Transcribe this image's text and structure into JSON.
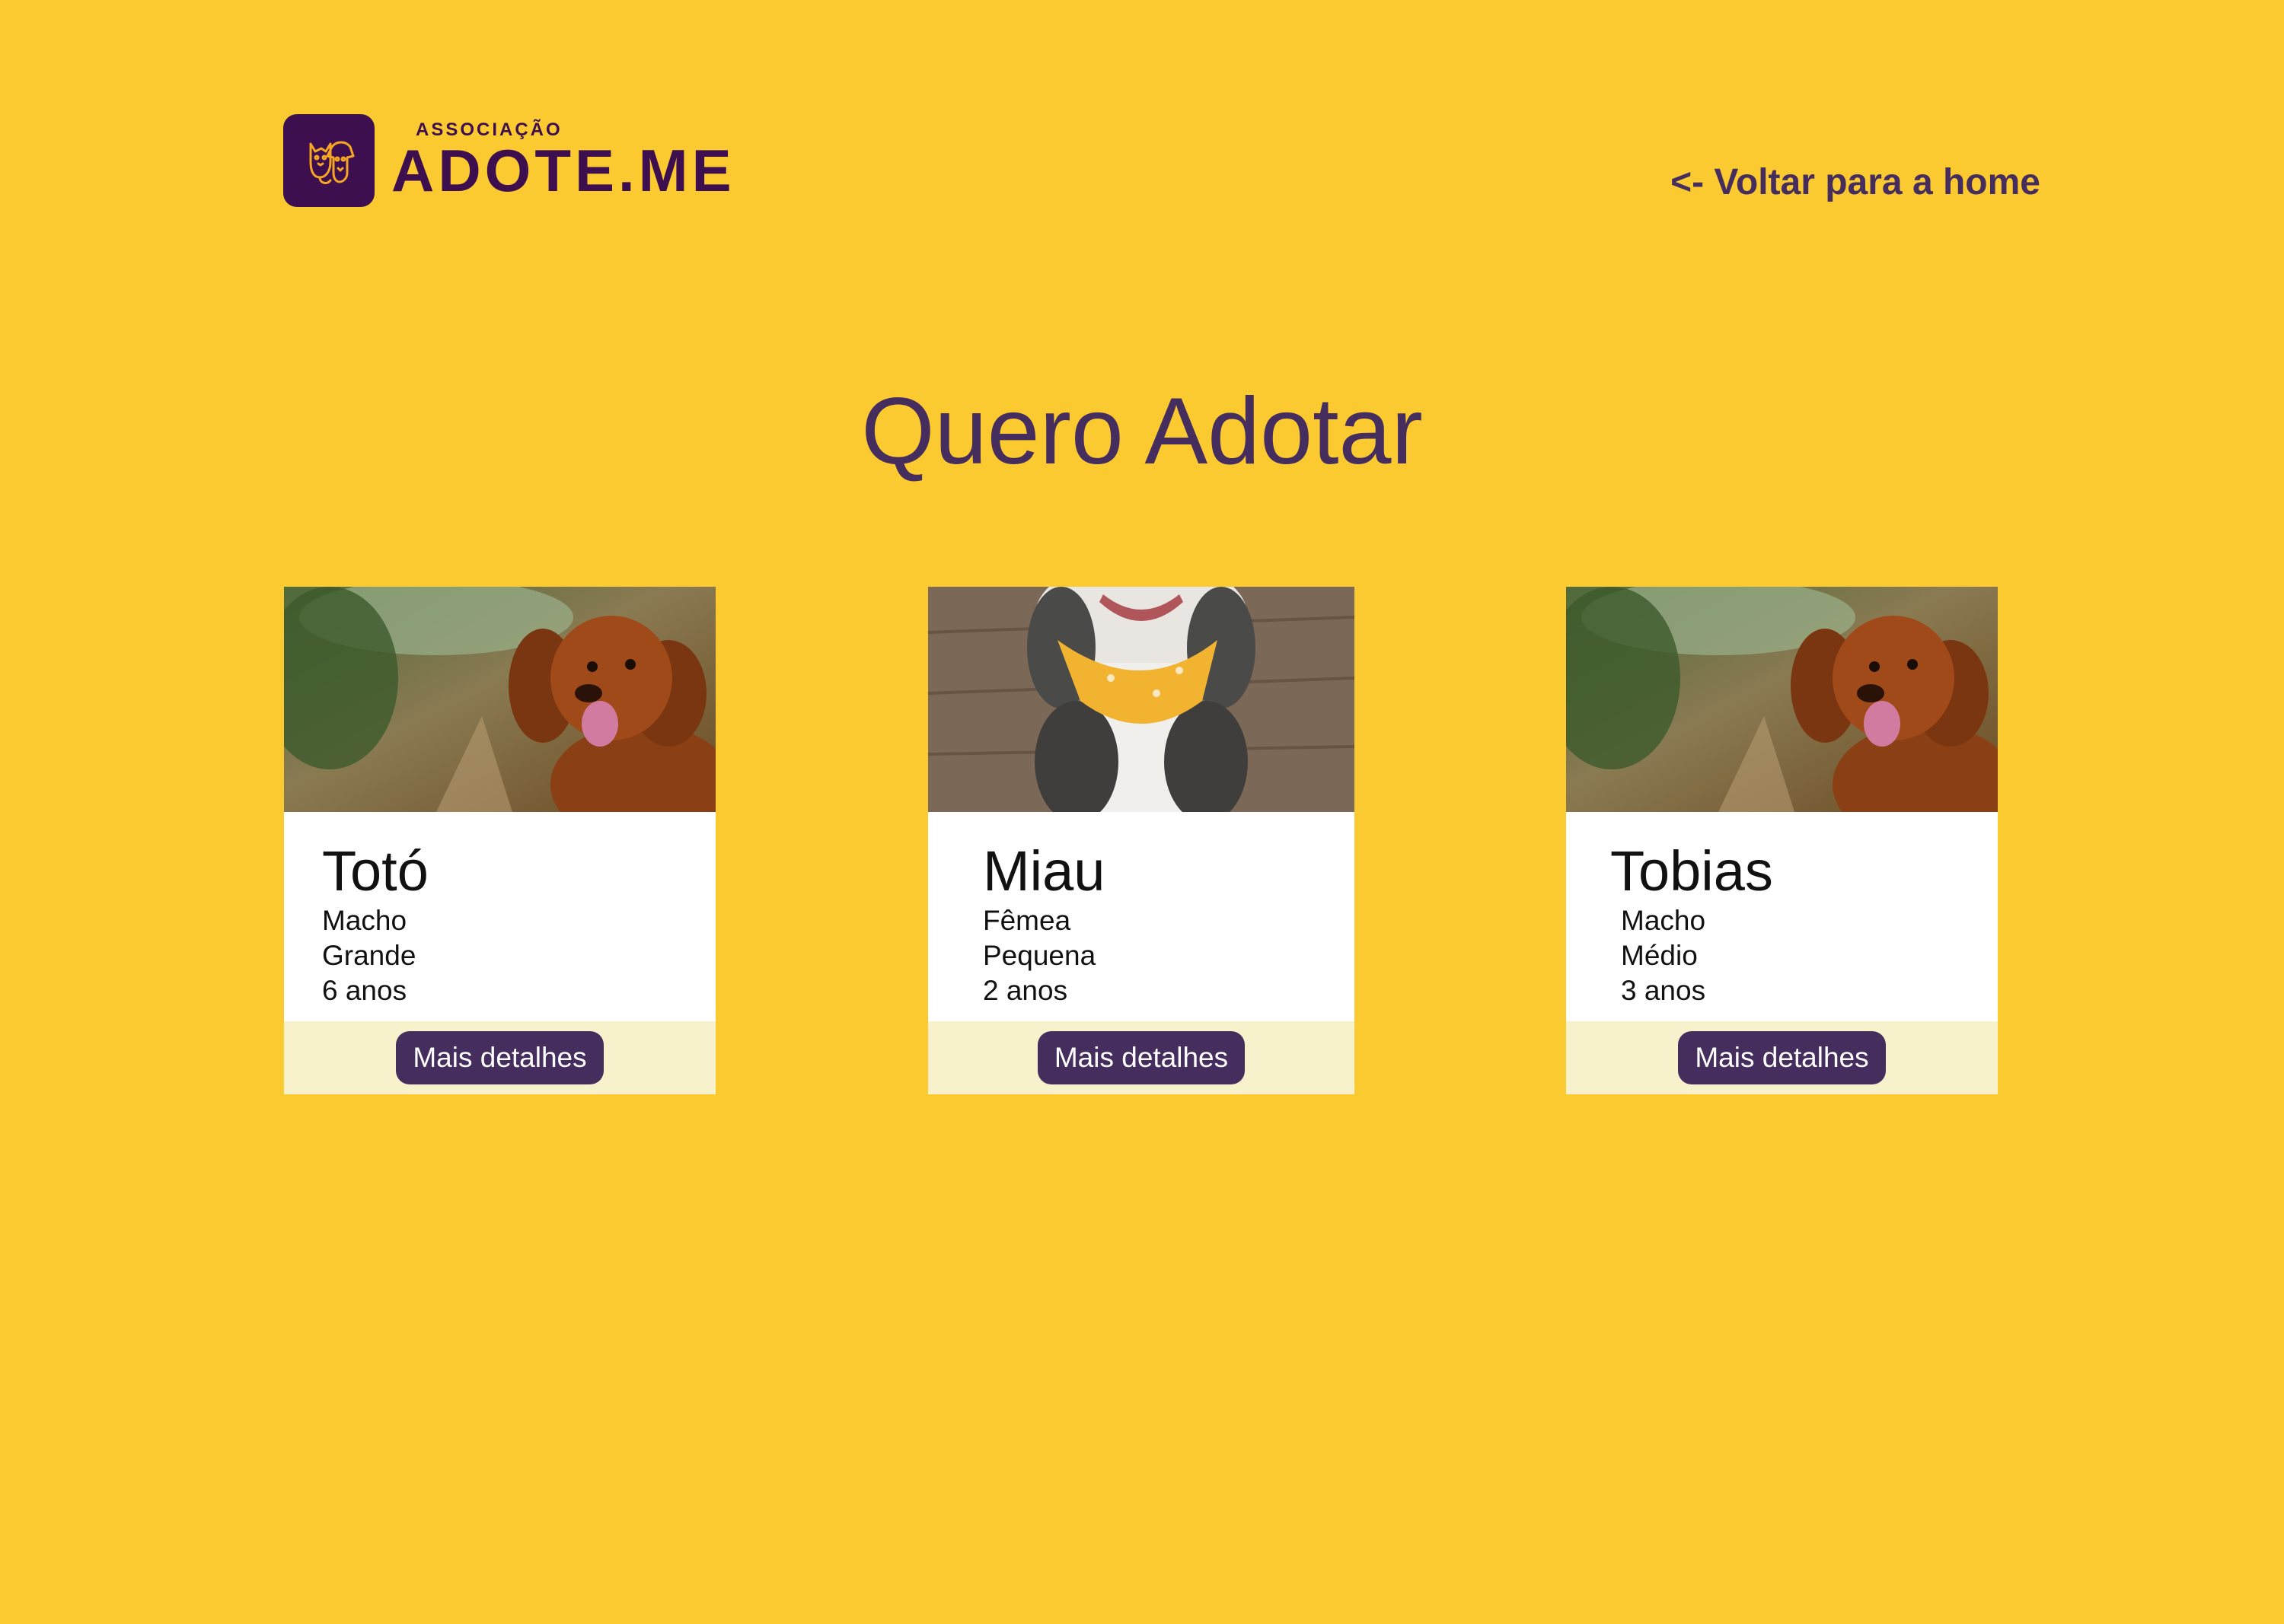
{
  "brand": {
    "small": "ASSOCIAÇÃO",
    "big": "ADOTE.ME",
    "color": "#3d0f4f"
  },
  "nav": {
    "back_label": "<- Voltar para a home"
  },
  "page": {
    "title": "Quero Adotar",
    "background": "#fbca30",
    "accent": "#452d5e"
  },
  "pets": [
    {
      "name": "Totó",
      "sex": "Macho",
      "size": "Grande",
      "age": "6 anos",
      "photo": "dog-photo",
      "button": "Mais detalhes"
    },
    {
      "name": "Miau",
      "sex": "Fêmea",
      "size": "Pequena",
      "age": "2 anos",
      "photo": "cat-photo",
      "button": "Mais detalhes"
    },
    {
      "name": "Tobias",
      "sex": "Macho",
      "size": "Médio",
      "age": "3 anos",
      "photo": "dog-photo",
      "button": "Mais detalhes"
    }
  ]
}
